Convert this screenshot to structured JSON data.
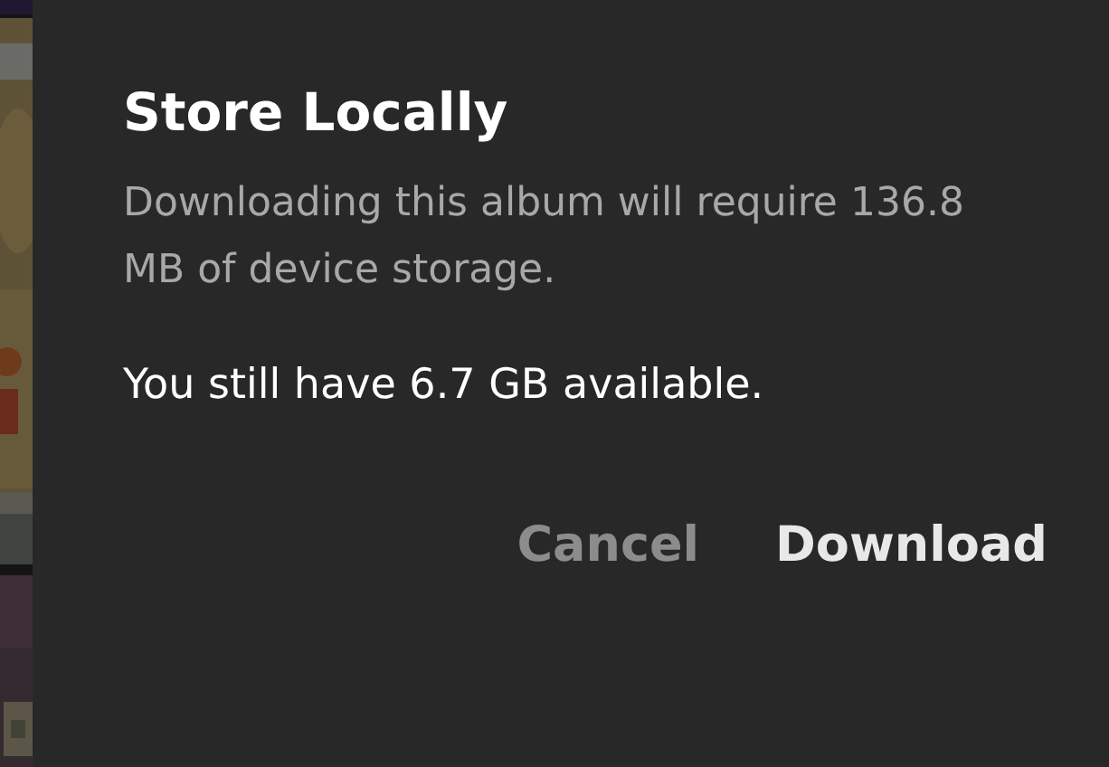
{
  "dialog": {
    "title": "Store Locally",
    "message": "Downloading this album will require 136.8 MB of device storage.",
    "note": "You still have 6.7 GB available.",
    "buttons": [
      {
        "label": "Cancel",
        "kind": "secondary"
      },
      {
        "label": "Download",
        "kind": "primary"
      }
    ]
  }
}
